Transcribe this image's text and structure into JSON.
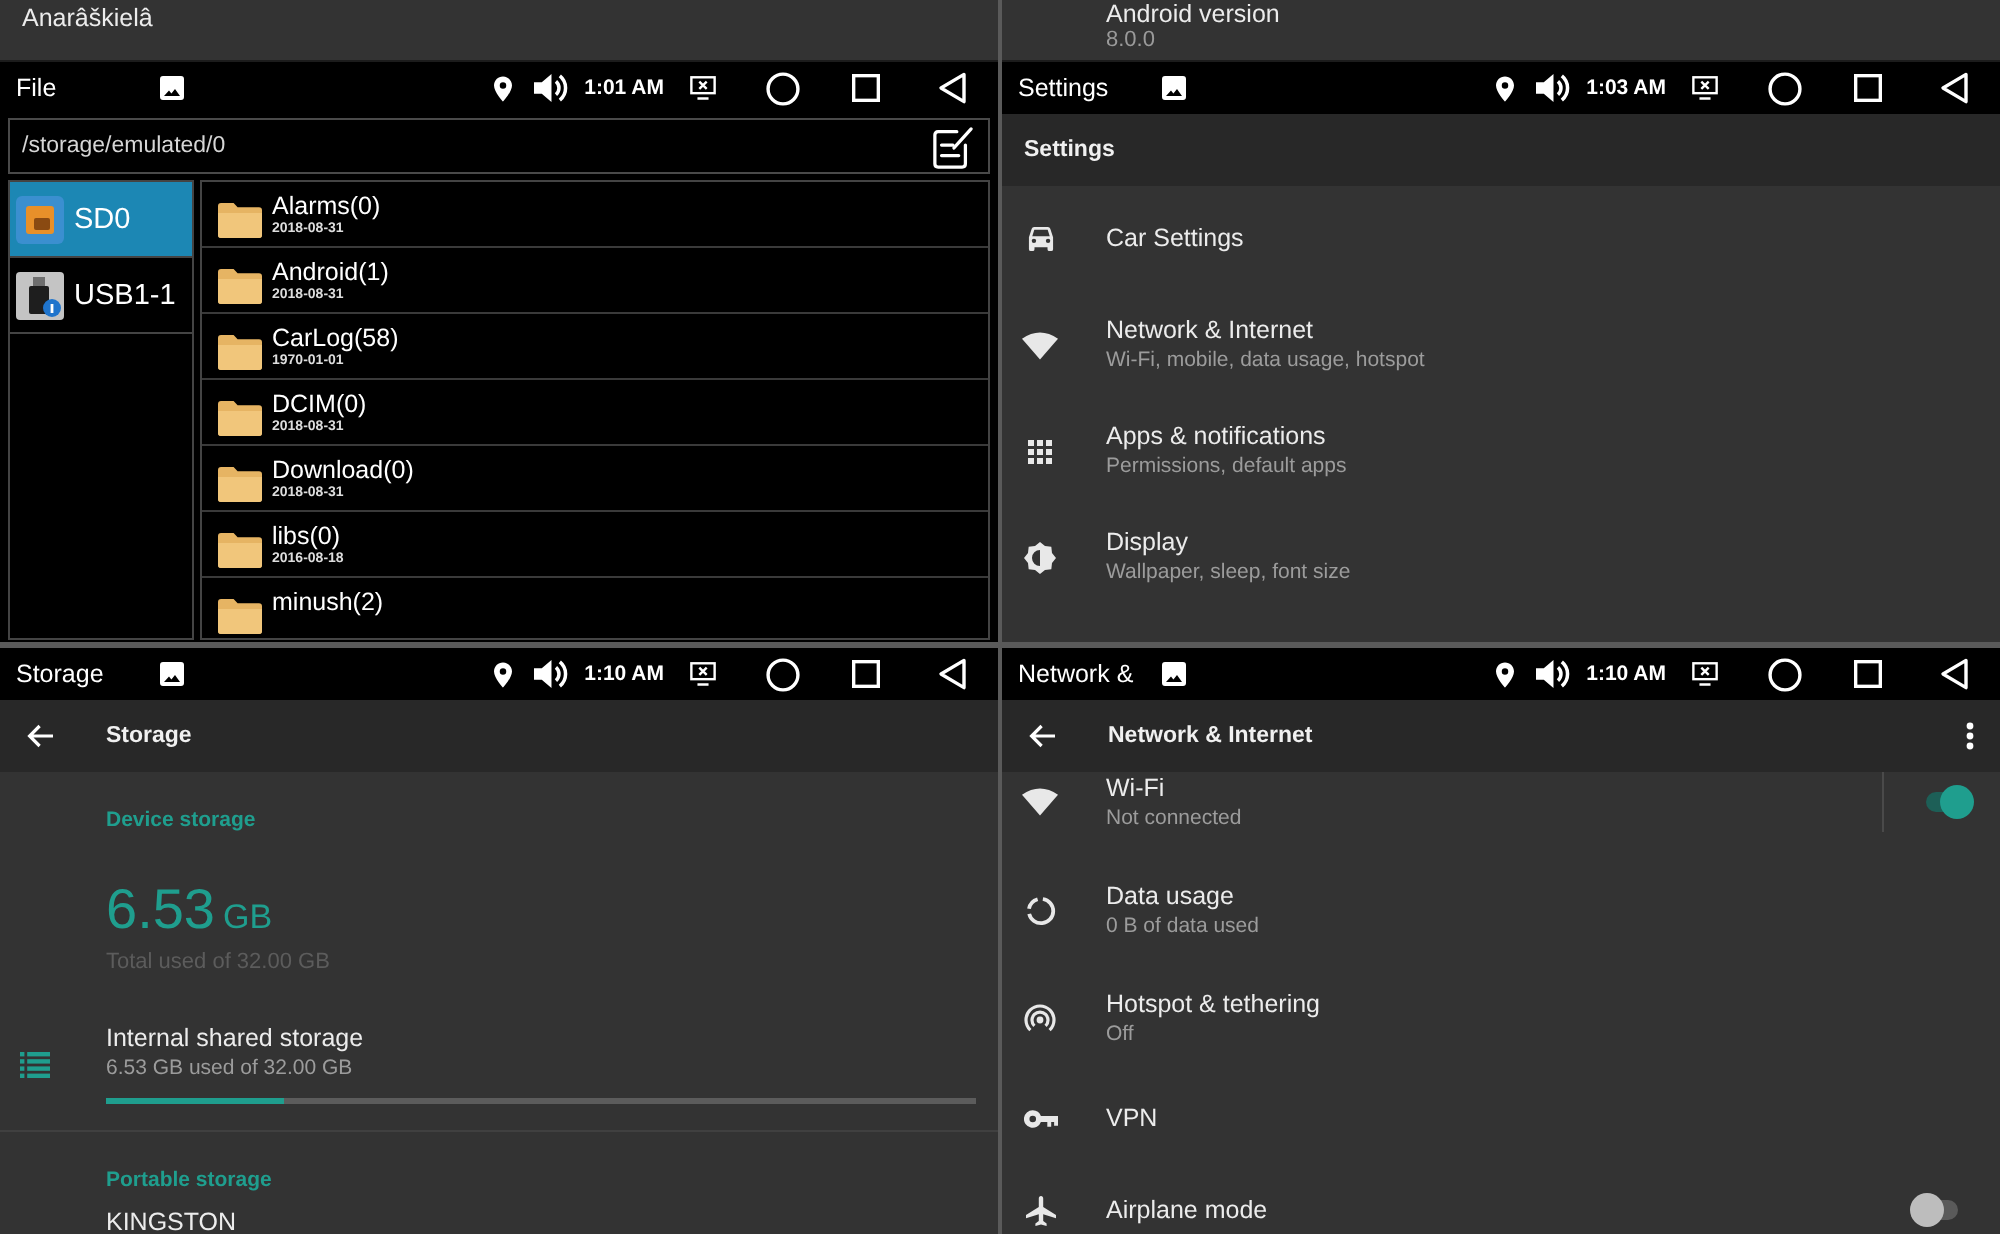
{
  "panels": [
    {
      "kind": "file_manager",
      "row_above": {
        "title": "Anarâškielâ"
      },
      "status_bar": {
        "app_title": "File",
        "time": "1:01 AM"
      },
      "path": "/storage/emulated/0",
      "drives": [
        {
          "label": "SD0",
          "selected": true
        },
        {
          "label": "USB1-1",
          "selected": false
        }
      ],
      "folders": [
        {
          "name": "Alarms(0)",
          "date": "2018-08-31"
        },
        {
          "name": "Android(1)",
          "date": "2018-08-31"
        },
        {
          "name": "CarLog(58)",
          "date": "1970-01-01"
        },
        {
          "name": "DCIM(0)",
          "date": "2018-08-31"
        },
        {
          "name": "Download(0)",
          "date": "2018-08-31"
        },
        {
          "name": "libs(0)",
          "date": "2016-08-18"
        },
        {
          "name": "minush(2)"
        }
      ]
    },
    {
      "kind": "settings",
      "row_above": {
        "title": "Android version",
        "summary": "8.0.0"
      },
      "status_bar": {
        "app_title": "Settings",
        "time": "1:03 AM"
      },
      "app_bar": {
        "title": "Settings"
      },
      "items": [
        {
          "title": "Car Settings"
        },
        {
          "title": "Network & Internet",
          "summary": "Wi-Fi, mobile, data usage, hotspot"
        },
        {
          "title": "Apps & notifications",
          "summary": "Permissions, default apps"
        },
        {
          "title": "Display",
          "summary": "Wallpaper, sleep, font size"
        }
      ]
    },
    {
      "kind": "storage",
      "status_bar": {
        "app_title": "Storage",
        "time": "1:10 AM"
      },
      "app_bar": {
        "title": "Storage",
        "back": true
      },
      "device_storage": {
        "heading": "Device storage",
        "used": "6.53",
        "unit": "GB",
        "caption": "Total used of 32.00 GB",
        "volumes": [
          {
            "title": "Internal shared storage",
            "summary": "6.53 GB used of 32.00 GB",
            "level": 0.204
          }
        ]
      },
      "portable_storage": {
        "heading": "Portable storage",
        "volumes": [
          {
            "title": "KINGSTON"
          }
        ]
      }
    },
    {
      "kind": "network",
      "status_bar": {
        "app_title": "Network &",
        "time": "1:10 AM"
      },
      "app_bar": {
        "title": "Network & Internet",
        "back": true,
        "menu": true
      },
      "items": [
        {
          "kind": "split_switch",
          "title": "Wi-Fi",
          "summary": "Not connected",
          "on": true
        },
        {
          "kind": "link",
          "title": "Data usage",
          "summary": "0 B of data used"
        },
        {
          "kind": "link",
          "title": "Hotspot & tethering",
          "summary": "Off"
        },
        {
          "kind": "link",
          "title": "VPN"
        },
        {
          "kind": "switch",
          "title": "Airplane mode",
          "on": false
        }
      ]
    }
  ]
}
